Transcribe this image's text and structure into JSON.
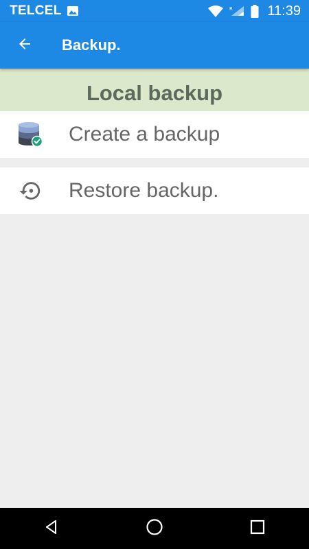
{
  "status_bar": {
    "carrier": "TELCEL",
    "time": "11:39",
    "icons": [
      "image-icon",
      "wifi-icon",
      "signal-icon",
      "battery-icon"
    ]
  },
  "app_bar": {
    "title": "Backup.",
    "back_icon": "arrow-back-icon"
  },
  "section": {
    "title": "Local backup"
  },
  "items": [
    {
      "label": "Create a backup",
      "icon": "database-check-icon"
    },
    {
      "label": "Restore backup.",
      "icon": "restore-icon"
    }
  ],
  "nav_bar": {
    "buttons": [
      "back-triangle-icon",
      "home-circle-icon",
      "recents-square-icon"
    ]
  },
  "colors": {
    "primary": "#1e88e5",
    "section_bg": "#dce8cc",
    "section_text": "#5b6a5c",
    "item_text": "#666666",
    "background": "#eeeeee",
    "check_accent": "#1aa37a"
  }
}
